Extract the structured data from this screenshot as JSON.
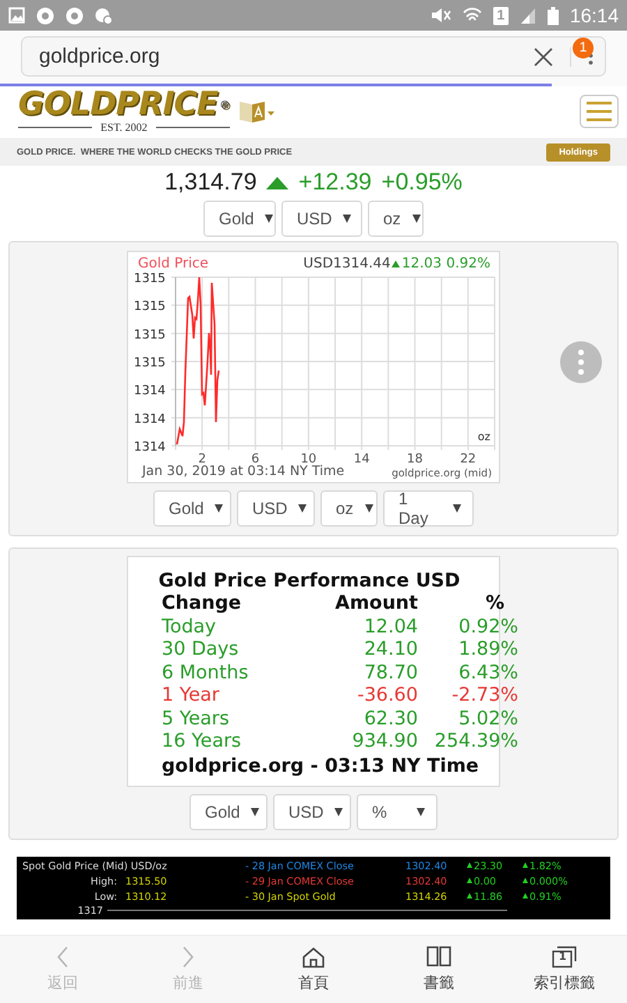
{
  "status_bar": {
    "sim_label": "1",
    "time": "16:14"
  },
  "browser": {
    "url": "goldprice.org",
    "notification_count": "1"
  },
  "site": {
    "logo": "GOLDPRICE",
    "registered": "®",
    "est": "EST. 2002",
    "tagline_brand": "GOLD PRICE.",
    "tagline": "WHERE THE WORLD CHECKS THE GOLD PRICE",
    "holdings_button": "Holdings"
  },
  "price": {
    "value": "1,314.79",
    "rising": true,
    "change": "+12.39",
    "percent": "+0.95%",
    "selects": [
      "Gold",
      "USD",
      "oz"
    ]
  },
  "chart_panel": {
    "title": "Gold Price",
    "quote": "USD1314.44",
    "rising": true,
    "change": "12.03",
    "percent": "0.92%",
    "y_labels": [
      "1315",
      "1315",
      "1315",
      "1315",
      "1314",
      "1314",
      "1314"
    ],
    "x_labels": [
      "2",
      "6",
      "10",
      "14",
      "18",
      "22"
    ],
    "unit": "oz",
    "timestamp": "Jan 30, 2019 at 03:14 NY Time",
    "source": "goldprice.org (mid)",
    "selects": [
      "Gold",
      "USD",
      "oz",
      "1 Day"
    ]
  },
  "performance": {
    "title": "Gold Price Performance USD",
    "columns": [
      "Change",
      "Amount",
      "%"
    ],
    "rows": [
      {
        "period": "Today",
        "amount": "12.04",
        "percent": "0.92%",
        "negative": false
      },
      {
        "period": "30 Days",
        "amount": "24.10",
        "percent": "1.89%",
        "negative": false
      },
      {
        "period": "6 Months",
        "amount": "78.70",
        "percent": "6.43%",
        "negative": false
      },
      {
        "period": "1 Year",
        "amount": "-36.60",
        "percent": "-2.73%",
        "negative": true
      },
      {
        "period": "5 Years",
        "amount": "62.30",
        "percent": "5.02%",
        "negative": false
      },
      {
        "period": "16 Years",
        "amount": "934.90",
        "percent": "254.39%",
        "negative": false
      }
    ],
    "footer": "goldprice.org - 03:13 NY Time",
    "selects": [
      "Gold",
      "USD",
      "%"
    ]
  },
  "ticker": {
    "title": "Spot Gold Price (Mid) USD/oz",
    "high_label": "High:",
    "high": "1315.50",
    "low_label": "Low:",
    "low": "1310.12",
    "axis_label": "1317",
    "rows": [
      {
        "label": "- 28 Jan COMEX Close",
        "price": "1302.40",
        "change": "23.30",
        "percent": "1.82%",
        "color": "#1e88e5"
      },
      {
        "label": "- 29 Jan COMEX Close",
        "price": "1302.40",
        "change": "0.00",
        "percent": "0.000%",
        "color": "#e53935"
      },
      {
        "label": "- 30 Jan Spot Gold",
        "price": "1314.26",
        "change": "11.86",
        "percent": "0.91%",
        "color": "#d4d400"
      }
    ]
  },
  "nav": [
    {
      "kind": "back",
      "label": "返回",
      "disabled": true
    },
    {
      "kind": "forward",
      "label": "前進",
      "disabled": true
    },
    {
      "kind": "home",
      "label": "首頁",
      "disabled": false
    },
    {
      "kind": "bookmarks",
      "label": "書籤",
      "disabled": false
    },
    {
      "kind": "tabs",
      "label": "索引標籤",
      "disabled": false,
      "badge": "1"
    }
  ]
}
